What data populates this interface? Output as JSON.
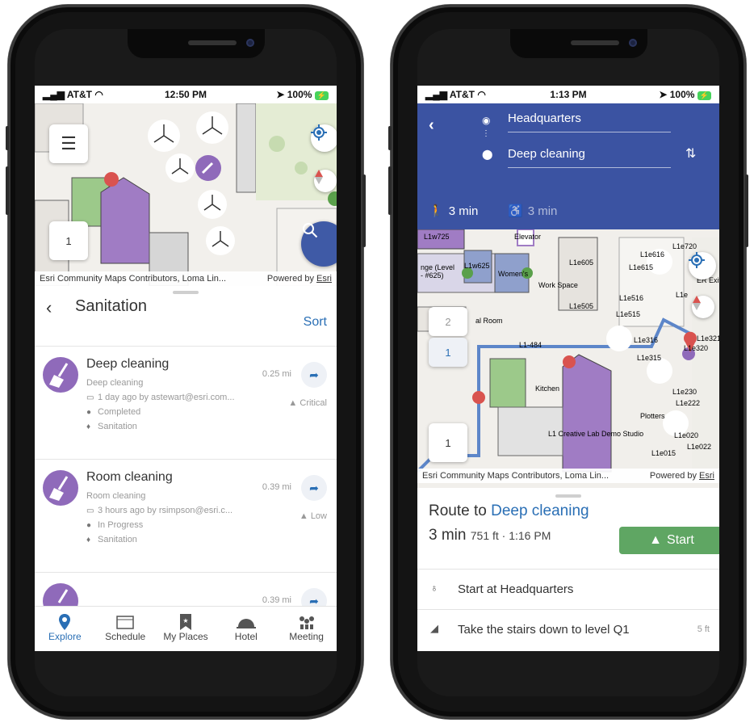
{
  "left_phone": {
    "status": {
      "carrier": "AT&T",
      "time": "12:50 PM",
      "battery": "100%"
    },
    "map": {
      "floor_button": "1",
      "attribution": "Esri Community Maps Contributors, Loma Lin...",
      "powered_by_prefix": "Powered by ",
      "powered_by_link": "Esri"
    },
    "list": {
      "title": "Sanitation",
      "sort_label": "Sort",
      "items": [
        {
          "name": "Deep cleaning",
          "subtitle": "Deep cleaning",
          "updated": "1 day ago by astewart@esri.com...",
          "status": "Completed",
          "category": "Sanitation",
          "distance": "0.25 mi",
          "priority": "Critical"
        },
        {
          "name": "Room cleaning",
          "subtitle": "Room cleaning",
          "updated": "3 hours ago by rsimpson@esri.c...",
          "status": "In Progress",
          "category": "Sanitation",
          "distance": "0.39 mi",
          "priority": "Low"
        },
        {
          "distance": "0.39 mi"
        }
      ]
    },
    "tabs": [
      {
        "label": "Explore",
        "icon": "map-pin-icon",
        "active": true
      },
      {
        "label": "Schedule",
        "icon": "calendar-icon",
        "active": false
      },
      {
        "label": "My Places",
        "icon": "bookmark-icon",
        "active": false
      },
      {
        "label": "Hotel",
        "icon": "hotel-bell-icon",
        "active": false
      },
      {
        "label": "Meeting",
        "icon": "people-icon",
        "active": false
      }
    ]
  },
  "right_phone": {
    "status": {
      "carrier": "AT&T",
      "time": "1:13 PM",
      "battery": "100%"
    },
    "route": {
      "origin": "Headquarters",
      "destination": "Deep cleaning",
      "walk_time": "3 min",
      "accessible_time": "3 min"
    },
    "map": {
      "level_buttons": [
        "2",
        "1"
      ],
      "floor_button": "1",
      "attribution": "Esri Community Maps Contributors, Loma Lin...",
      "powered_by_prefix": "Powered by ",
      "powered_by_link": "Esri",
      "labels": [
        "L1w725",
        "Elevator",
        "L1e605",
        "L1e616",
        "L1e615",
        "L1e720",
        "ER Exit",
        "Women's",
        "Work Space",
        "L1e505",
        "L1e516",
        "L1e515",
        "L1e",
        "L1e316",
        "L1e315",
        "L1e320",
        "L1e321",
        "L1-484",
        "Kitchen",
        "L1e230",
        "L1e222",
        "Plotters",
        "L1 Creative Lab Demo Studio",
        "L1e015",
        "L1e020",
        "L1e022",
        "nge (Level",
        "- #625)",
        "L1w625",
        "al Room"
      ]
    },
    "panel": {
      "route_to": "Route to",
      "destination": "Deep cleaning",
      "duration": "3 min",
      "details": "751 ft · 1:16 PM",
      "start_label": "Start",
      "steps": [
        {
          "text": "Start at Headquarters",
          "icon": "person-start-icon",
          "distance": ""
        },
        {
          "text": "Take the stairs down to level Q1",
          "icon": "stairs-icon",
          "distance": "5 ft"
        }
      ]
    }
  },
  "colors": {
    "accent_blue": "#2a6fb5",
    "header_blue": "#3b53a2",
    "purple": "#8f6aba",
    "start_green": "#5fa663"
  }
}
